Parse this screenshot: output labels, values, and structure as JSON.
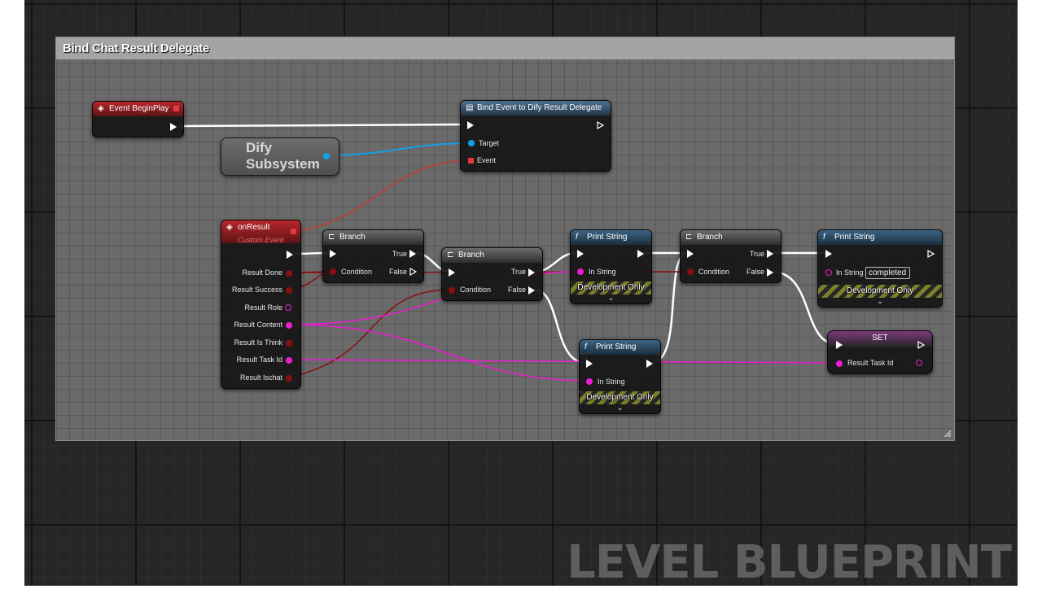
{
  "comment": {
    "title": "Bind Chat Result Delegate"
  },
  "watermark": "LEVEL BLUEPRINT",
  "nodes": {
    "event_begin_play": {
      "title": "Event BeginPlay"
    },
    "bind_event": {
      "title": "Bind Event to Dify Result Delegate",
      "pins": [
        "Target",
        "Event"
      ]
    },
    "dify_subsystem": {
      "title": "Dify Subsystem"
    },
    "on_result": {
      "title": "onResult",
      "subtitle": "Custom Event",
      "pins": [
        "Result Done",
        "Result Success",
        "Result Role",
        "Result Content",
        "Result Is Think",
        "Result Task Id",
        "Result Ischat"
      ]
    },
    "branch_1": {
      "title": "Branch",
      "condition": "Condition",
      "true_label": "True",
      "false_label": "False"
    },
    "branch_2": {
      "title": "Branch",
      "condition": "Condition",
      "true_label": "True",
      "false_label": "False"
    },
    "branch_3": {
      "title": "Branch",
      "condition": "Condition",
      "true_label": "True",
      "false_label": "False"
    },
    "print_1": {
      "title": "Print String",
      "in_string": "In String",
      "dev_only": "Development Only"
    },
    "print_2": {
      "title": "Print String",
      "in_string": "In String",
      "dev_only": "Development Only"
    },
    "print_3": {
      "title": "Print String",
      "in_string": "In String",
      "in_string_value": "completed",
      "dev_only": "Development Only"
    },
    "set_node": {
      "title": "SET",
      "pin": "Result Task Id"
    }
  },
  "colors": {
    "exec_wire": "#ffffff",
    "object_wire": "#12a0e8",
    "bool_wire": "#8a1010",
    "string_wire": "#ef1cd4",
    "delegate_wire": "#c23a34",
    "event_header": "#b9272b",
    "function_header": "#3c6486"
  },
  "icons": {
    "event": "event-diamond-icon",
    "function": "function-f-icon",
    "branch": "branch-icon",
    "bind": "bind-event-icon"
  }
}
